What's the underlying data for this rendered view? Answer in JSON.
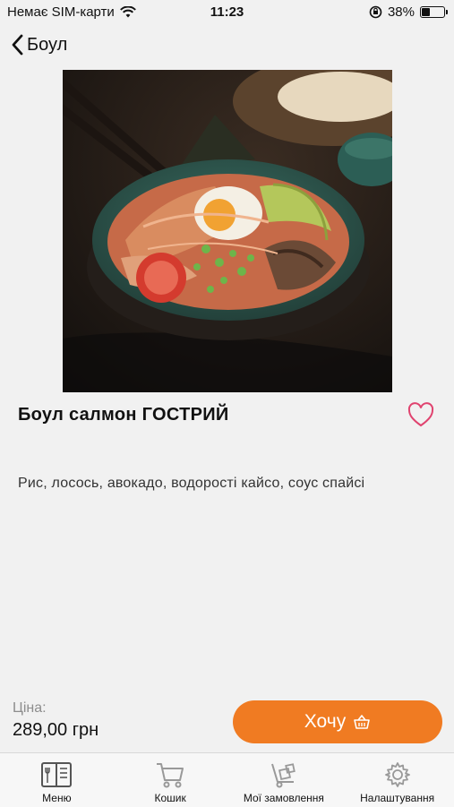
{
  "status_bar": {
    "carrier": "Немає SIM-карти",
    "time": "11:23",
    "battery_percent": "38%",
    "battery_level": 0.38
  },
  "nav": {
    "back_label": "Боул"
  },
  "product": {
    "title": "Боул салмон ГОСТРИЙ",
    "description": "Рис, лосось, авокадо, водорості кайсо, соус спайсі",
    "is_favorite": false
  },
  "purchase": {
    "price_label": "Ціна:",
    "price_value": "289,00 грн",
    "button_label": "Хочу"
  },
  "tabbar": {
    "items": [
      {
        "label": "Меню",
        "icon": "menu-book-icon"
      },
      {
        "label": "Кошик",
        "icon": "cart-icon"
      },
      {
        "label": "Мої замовлення",
        "icon": "delivery-cart-icon"
      },
      {
        "label": "Налаштування",
        "icon": "gear-icon"
      }
    ]
  },
  "colors": {
    "accent": "#f07b22",
    "favorite": "#e0436f",
    "background": "#f1f1f1"
  }
}
